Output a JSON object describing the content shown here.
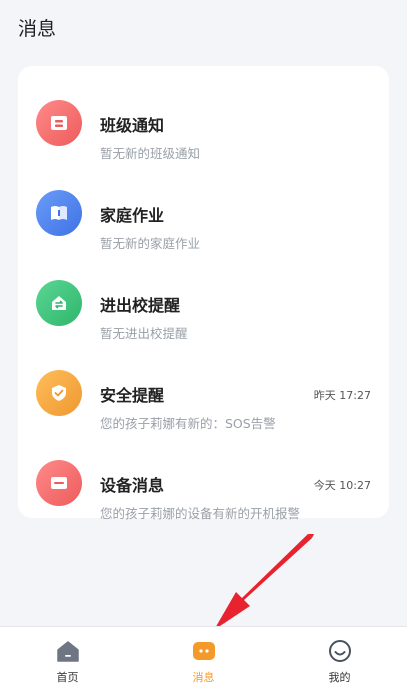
{
  "header": {
    "title": "消息"
  },
  "messages": [
    {
      "name": "班级通知",
      "sub": "暂无新的班级通知",
      "time": "",
      "icon": "mailbox-icon",
      "color": "#f26b6b"
    },
    {
      "name": "家庭作业",
      "sub": "暂无新的家庭作业",
      "time": "",
      "icon": "book-icon",
      "color": "#4f86ee"
    },
    {
      "name": "进出校提醒",
      "sub": "暂无进出校提醒",
      "time": "",
      "icon": "swap-icon",
      "color": "#3cc47c"
    },
    {
      "name": "安全提醒",
      "sub": "您的孩子莉娜有新的：SOS告警",
      "time": "昨天 17:27",
      "icon": "shield-check-icon",
      "color": "#f3a53c"
    },
    {
      "name": "设备消息",
      "sub": "您的孩子莉娜的设备有新的开机报警",
      "time": "今天 10:27",
      "icon": "card-icon",
      "color": "#f26b6b"
    }
  ],
  "tabbar": {
    "tabs": [
      {
        "label": "首页",
        "icon": "home-icon"
      },
      {
        "label": "消息",
        "icon": "message-icon",
        "active": true
      },
      {
        "label": "我的",
        "icon": "smiley-icon"
      }
    ],
    "accent": "#f39a2b"
  },
  "annotation": {
    "icon": "red-arrow",
    "color": "#e8232f"
  }
}
